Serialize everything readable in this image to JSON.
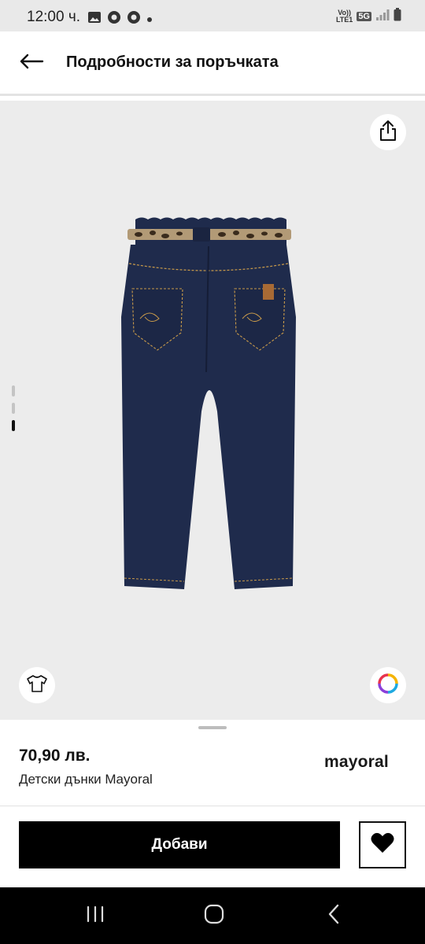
{
  "status_bar": {
    "time": "12:00 ч.",
    "network_top": "Vo))",
    "network_bottom": "LTE1",
    "network_type": "5G"
  },
  "header": {
    "title": "Подробности за поръчката"
  },
  "product": {
    "price": "70,90 лв.",
    "name": "Детски дънки Mayoral",
    "brand": "mayoral"
  },
  "actions": {
    "add_label": "Добави"
  },
  "gallery": {
    "image_count": 3,
    "active_index": 2
  },
  "colors": {
    "denim": "#1f2b4c",
    "status_bg": "#e9e9e9",
    "image_bg": "#ececec",
    "primary": "#000000"
  }
}
